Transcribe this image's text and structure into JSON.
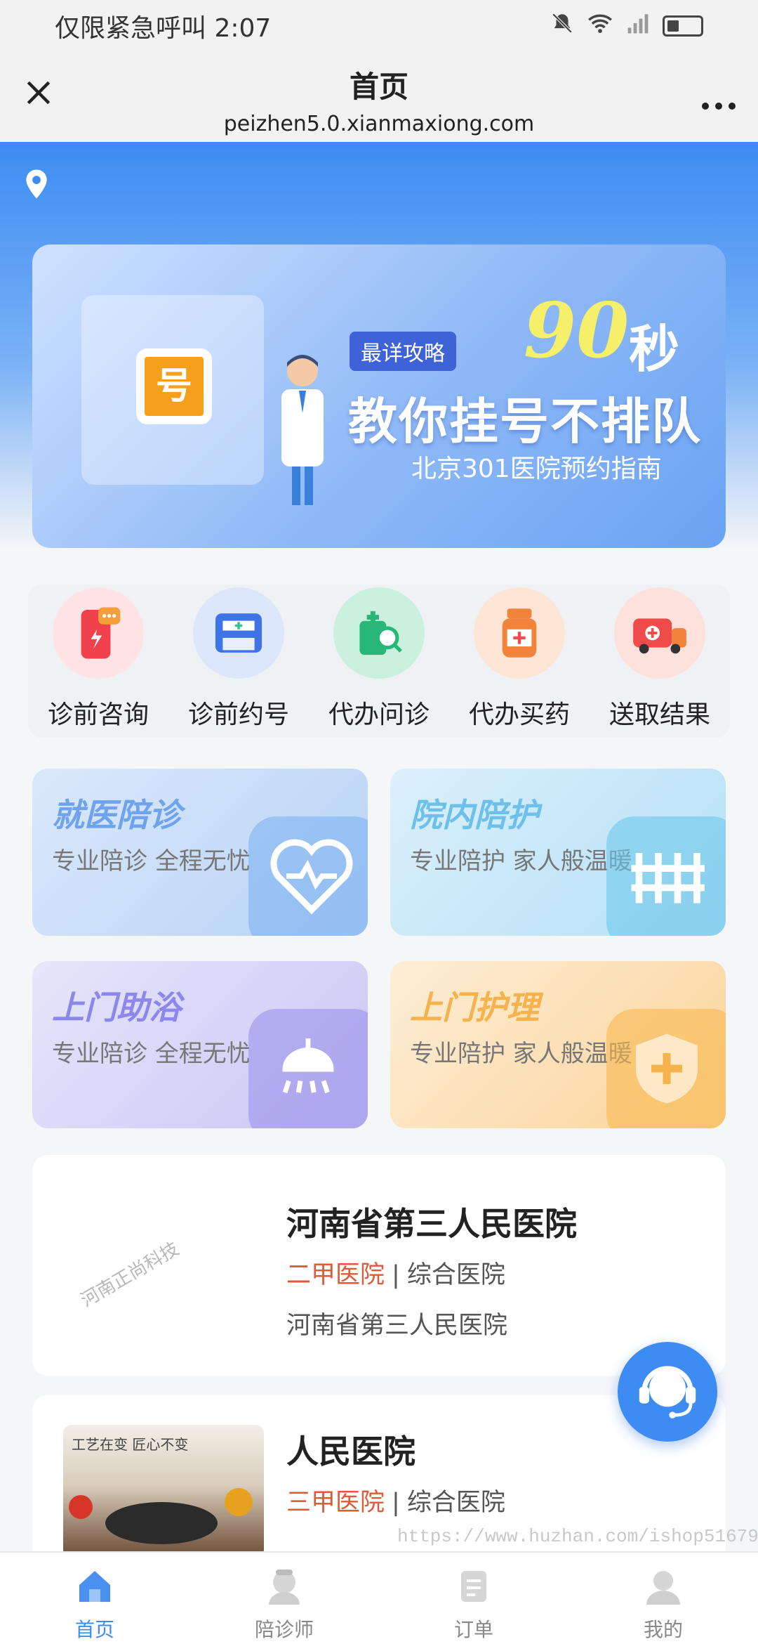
{
  "status_bar": {
    "left_text": "仅限紧急呼叫 2:07"
  },
  "nav": {
    "title": "首页",
    "url": "peizhen5.0.xianmaxiong.com"
  },
  "banner": {
    "tag": "最详攻略",
    "big_number": "90",
    "seconds": "秒",
    "headline": "教你挂号不排队",
    "subline": "北京301医院预约指南",
    "icon_text": "号"
  },
  "quick_actions": [
    {
      "label": "诊前咨询",
      "icon": "phone-chat-icon",
      "color": "#f4444f"
    },
    {
      "label": "诊前约号",
      "icon": "ticket-printer-icon",
      "color": "#4a7cf0"
    },
    {
      "label": "代办问诊",
      "icon": "search-doctor-icon",
      "color": "#2fc48a"
    },
    {
      "label": "代办买药",
      "icon": "medicine-bottle-icon",
      "color": "#f2833a"
    },
    {
      "label": "送取结果",
      "icon": "ambulance-icon",
      "color": "#ef4b4b"
    }
  ],
  "service_cards": [
    {
      "title": "就医陪诊",
      "subtitle": "专业陪诊 全程无忧",
      "color": "#6fa3ee"
    },
    {
      "title": "院内陪护",
      "subtitle": "专业陪护 家人般温暖",
      "color": "#6cc0ea"
    },
    {
      "title": "上门助浴",
      "subtitle": "专业陪诊 全程无忧",
      "color": "#8c87ea"
    },
    {
      "title": "上门护理",
      "subtitle": "专业陪护 家人般温暖",
      "color": "#f5b24d"
    }
  ],
  "hospitals": [
    {
      "name": "河南省第三人民医院",
      "level": "二甲医院",
      "type": "综合医院",
      "address": "河南省第三人民医院",
      "thumb_text": "河南正尚科技"
    },
    {
      "name": "人民医院",
      "level": "三甲医院",
      "type": "综合医院",
      "thumb_text": "工艺在变 匠心不变"
    }
  ],
  "watermark": "https://www.huzhan.com/ishop51679",
  "tabbar": [
    {
      "label": "首页",
      "active": true
    },
    {
      "label": "陪诊师",
      "active": false
    },
    {
      "label": "订单",
      "active": false
    },
    {
      "label": "我的",
      "active": false
    }
  ]
}
